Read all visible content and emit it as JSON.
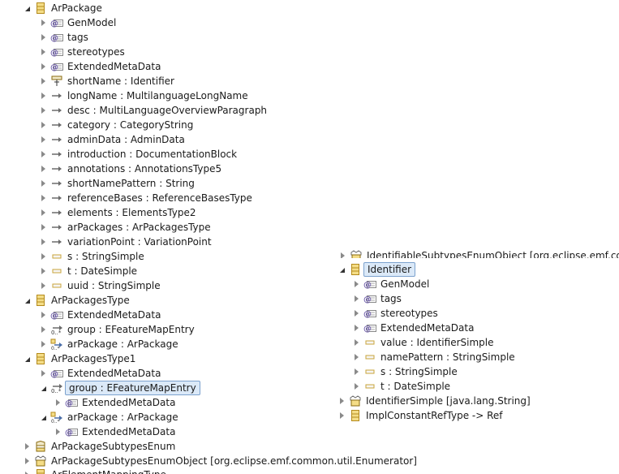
{
  "left_tree": [
    {
      "label": "ArPackage",
      "icon": "class-icon",
      "arrow": "expanded"
    },
    {
      "label": "GenModel",
      "icon": "annotation-icon",
      "arrow": "collapsed"
    },
    {
      "label": "tags",
      "icon": "annotation-icon",
      "arrow": "collapsed"
    },
    {
      "label": "stereotypes",
      "icon": "annotation-icon",
      "arrow": "collapsed"
    },
    {
      "label": "ExtendedMetaData",
      "icon": "annotation-icon",
      "arrow": "collapsed"
    },
    {
      "label": "shortName : Identifier",
      "icon": "id-attribute-icon",
      "arrow": "collapsed"
    },
    {
      "label": "longName : MultilanguageLongName",
      "icon": "reference-icon",
      "arrow": "collapsed"
    },
    {
      "label": "desc : MultiLanguageOverviewParagraph",
      "icon": "reference-icon",
      "arrow": "collapsed"
    },
    {
      "label": "category : CategoryString",
      "icon": "reference-icon",
      "arrow": "collapsed"
    },
    {
      "label": "adminData : AdminData",
      "icon": "reference-icon",
      "arrow": "collapsed"
    },
    {
      "label": "introduction : DocumentationBlock",
      "icon": "reference-icon",
      "arrow": "collapsed"
    },
    {
      "label": "annotations : AnnotationsType5",
      "icon": "reference-icon",
      "arrow": "collapsed"
    },
    {
      "label": "shortNamePattern : String",
      "icon": "reference-icon",
      "arrow": "collapsed"
    },
    {
      "label": "referenceBases : ReferenceBasesType",
      "icon": "reference-icon",
      "arrow": "collapsed"
    },
    {
      "label": "elements : ElementsType2",
      "icon": "reference-icon",
      "arrow": "collapsed"
    },
    {
      "label": "arPackages : ArPackagesType",
      "icon": "reference-icon",
      "arrow": "collapsed"
    },
    {
      "label": "variationPoint : VariationPoint",
      "icon": "reference-icon",
      "arrow": "collapsed"
    },
    {
      "label": "s : StringSimple",
      "icon": "attribute-icon",
      "arrow": "collapsed"
    },
    {
      "label": "t : DateSimple",
      "icon": "attribute-icon",
      "arrow": "collapsed"
    },
    {
      "label": "uuid : StringSimple",
      "icon": "attribute-icon",
      "arrow": "collapsed"
    },
    {
      "label": "ArPackagesType",
      "icon": "class-icon",
      "arrow": "expanded"
    },
    {
      "label": "ExtendedMetaData",
      "icon": "annotation-icon",
      "arrow": "collapsed"
    },
    {
      "label": "group : EFeatureMapEntry",
      "icon": "feature-map-icon",
      "arrow": "collapsed"
    },
    {
      "label": "arPackage : ArPackage",
      "icon": "derived-reference-icon",
      "arrow": "collapsed"
    },
    {
      "label": "ArPackagesType1",
      "icon": "class-icon",
      "arrow": "expanded"
    },
    {
      "label": "ExtendedMetaData",
      "icon": "annotation-icon",
      "arrow": "collapsed"
    },
    {
      "label": "group : EFeatureMapEntry",
      "icon": "feature-map-icon",
      "arrow": "expanded",
      "selected": true
    },
    {
      "label": "ExtendedMetaData",
      "icon": "annotation-icon",
      "arrow": "collapsed"
    },
    {
      "label": "arPackage : ArPackage",
      "icon": "derived-reference-icon",
      "arrow": "expanded"
    },
    {
      "label": "ExtendedMetaData",
      "icon": "annotation-icon",
      "arrow": "collapsed"
    },
    {
      "label": "ArPackageSubtypesEnum",
      "icon": "enum-icon",
      "arrow": "collapsed"
    },
    {
      "label": "ArPackageSubtypesEnumObject [org.eclipse.emf.common.util.Enumerator]",
      "icon": "datatype-icon",
      "arrow": "collapsed"
    }
  ],
  "left_bottom_partial": {
    "label": "ArElementMappingType",
    "icon": "class-icon",
    "arrow": "collapsed"
  },
  "right_partial": {
    "label": "IdentifiableSubtypesEnumObject [org.eclipse.emf.comm",
    "icon": "datatype-icon",
    "arrow": "collapsed"
  },
  "right_tree": [
    {
      "label": "Identifier",
      "icon": "class-icon",
      "arrow": "expanded",
      "boxed": true
    },
    {
      "label": "GenModel",
      "icon": "annotation-icon",
      "arrow": "collapsed"
    },
    {
      "label": "tags",
      "icon": "annotation-icon",
      "arrow": "collapsed"
    },
    {
      "label": "stereotypes",
      "icon": "annotation-icon",
      "arrow": "collapsed"
    },
    {
      "label": "ExtendedMetaData",
      "icon": "annotation-icon",
      "arrow": "collapsed"
    },
    {
      "label": "value : IdentifierSimple",
      "icon": "attribute-icon",
      "arrow": "collapsed"
    },
    {
      "label": "namePattern : StringSimple",
      "icon": "attribute-icon",
      "arrow": "collapsed"
    },
    {
      "label": "s : StringSimple",
      "icon": "attribute-icon",
      "arrow": "collapsed"
    },
    {
      "label": "t : DateSimple",
      "icon": "attribute-icon",
      "arrow": "collapsed"
    },
    {
      "label": "IdentifierSimple [java.lang.String]",
      "icon": "datatype-icon",
      "arrow": "collapsed"
    },
    {
      "label": "ImplConstantRefType -> Ref",
      "icon": "class-icon",
      "arrow": "collapsed"
    }
  ],
  "colors": {
    "selection_bg": "#dbe9f8",
    "selection_border": "#7da2ce",
    "class_icon": "#e7c35b",
    "annotation_icon": "#7f7f7f"
  }
}
